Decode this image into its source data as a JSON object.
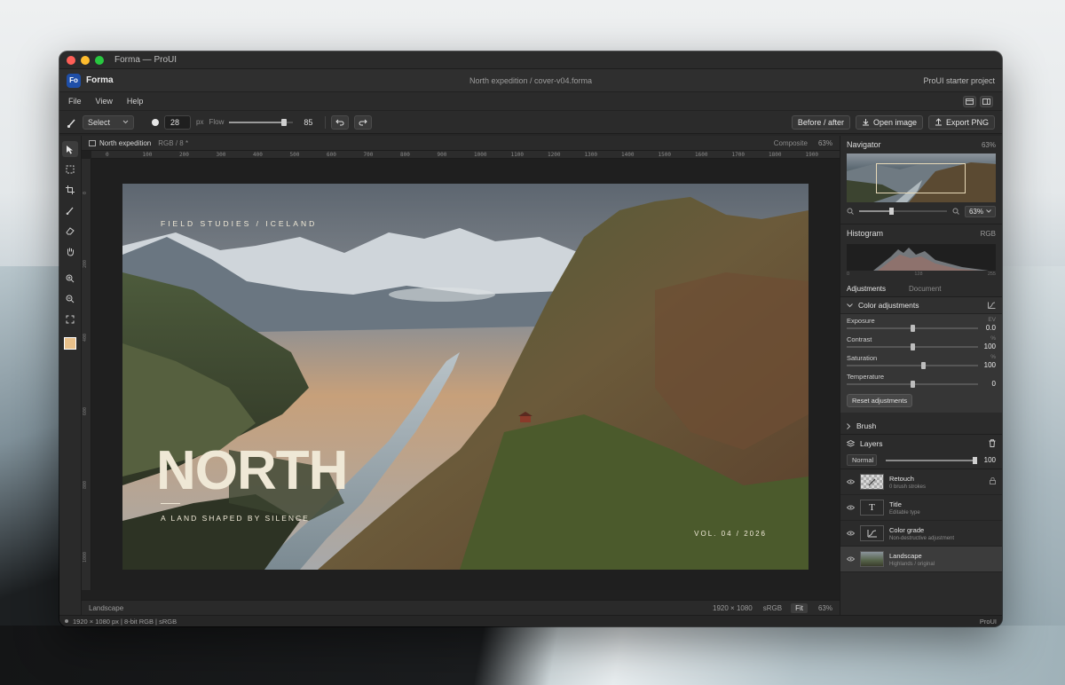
{
  "window": {
    "title": "Forma — ProUI"
  },
  "appbar": {
    "logo": "Fo",
    "app_name": "Forma",
    "doc_path": "North expedition / cover-v04.forma",
    "project": "ProUI starter project"
  },
  "menu": [
    "File",
    "View",
    "Help"
  ],
  "toolbar": {
    "tool_select": "Select",
    "brush_size": "28",
    "size_unit": "px",
    "flow_label": "Flow",
    "flow_value": "85",
    "flow_fraction": 0.85,
    "before_after": "Before / after",
    "open_image": "Open image",
    "export_png": "Export PNG"
  },
  "document": {
    "tab_name": "North expedition",
    "tab_meta": "RGB / 8 *",
    "composite_label": "Composite",
    "composite_zoom": "63%",
    "ruler_h_ticks": [
      "0",
      "100",
      "200",
      "300",
      "400",
      "500",
      "600",
      "700",
      "800",
      "900",
      "1000",
      "1100",
      "1200",
      "1300",
      "1400",
      "1500",
      "1600",
      "1700",
      "1800",
      "1900"
    ],
    "ruler_v_ticks": [
      "0",
      "200",
      "400",
      "600",
      "800",
      "1000"
    ],
    "artwork": {
      "kicker": "FIELD STUDIES / ICELAND",
      "title": "NORTH",
      "subtitle": "A LAND SHAPED BY SILENCE",
      "volume": "VOL. 04 / 2026"
    },
    "status": {
      "layer": "Landscape",
      "dimensions": "1920 × 1080",
      "color_space": "sRGB",
      "fit": "Fit",
      "zoom": "63%"
    }
  },
  "panel": {
    "navigator": {
      "title": "Navigator",
      "zoom": "63%",
      "zoom_select": "63%",
      "zoom_fraction": 0.35
    },
    "histogram": {
      "title": "Histogram",
      "channel": "RGB",
      "axis": [
        "0",
        "128",
        "255"
      ]
    },
    "tabs": [
      "Adjustments",
      "Document"
    ],
    "color_adjustments": {
      "title": "Color adjustments",
      "rows": [
        {
          "label": "Exposure",
          "unit": "EV",
          "value": "0.0",
          "position": 0.5
        },
        {
          "label": "Contrast",
          "unit": "%",
          "value": "100",
          "position": 0.5
        },
        {
          "label": "Saturation",
          "unit": "%",
          "value": "100",
          "position": 0.58
        },
        {
          "label": "Temperature",
          "unit": "",
          "value": "0",
          "position": 0.5
        }
      ],
      "reset": "Reset adjustments"
    },
    "brush": {
      "title": "Brush"
    },
    "layers": {
      "title": "Layers",
      "blend": "Normal",
      "opacity": "100",
      "items": [
        {
          "name": "Retouch",
          "sub": "0 brush strokes"
        },
        {
          "name": "Title",
          "sub": "Editable type"
        },
        {
          "name": "Color grade",
          "sub": "Non-destructive adjustment"
        },
        {
          "name": "Landscape",
          "sub": "Highlands / original"
        }
      ]
    }
  },
  "statusbar": {
    "info": "1920 × 1080 px | 8-bit RGB | sRGB",
    "brand": "ProUI"
  }
}
